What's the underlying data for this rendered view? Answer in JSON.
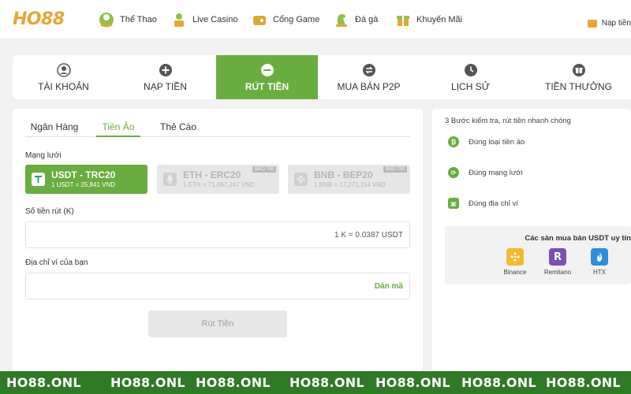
{
  "brand": {
    "logo_left": "HO",
    "logo_right": "88"
  },
  "nav": {
    "items": [
      {
        "label": "Thể Thao",
        "icon": "soccer-ball-icon"
      },
      {
        "label": "Live Casino",
        "icon": "dealer-icon"
      },
      {
        "label": "Cổng Game",
        "icon": "game-icon"
      },
      {
        "label": "Đá gà",
        "icon": "rooster-icon"
      },
      {
        "label": "Khuyến Mãi",
        "icon": "gift-icon"
      }
    ],
    "deposit_link": "Nạp tiền"
  },
  "tabs": [
    {
      "label": "TÀI KHOẢN",
      "icon": "user-icon",
      "active": false
    },
    {
      "label": "NẠP TIỀN",
      "icon": "plus-circle-icon",
      "active": false
    },
    {
      "label": "RÚT TIỀN",
      "icon": "minus-circle-icon",
      "active": true
    },
    {
      "label": "MUA BÁN P2P",
      "icon": "exchange-icon",
      "active": false
    },
    {
      "label": "LỊCH SỬ",
      "icon": "clock-icon",
      "active": false
    },
    {
      "label": "TIỀN THƯỞNG",
      "icon": "gift-icon",
      "active": false
    }
  ],
  "withdraw": {
    "subtabs": [
      "Ngân Hàng",
      "Tiền Ảo",
      "Thẻ Cào"
    ],
    "active_subtab": "Tiền Ảo",
    "network_label": "Mạng lưới",
    "networks": [
      {
        "name": "USDT - TRC20",
        "rate": "1 USDT = 25,841 VND",
        "active": true,
        "badge": ""
      },
      {
        "name": "ETH - ERC20",
        "rate": "1 ETH = 71,067,247 VND",
        "active": false,
        "badge": "BẢO TRÌ"
      },
      {
        "name": "BNB - BEP20",
        "rate": "1 BNB = 17,271,114 VND",
        "active": false,
        "badge": "BẢO TRÌ"
      }
    ],
    "amount_label": "Số tiền rút (K)",
    "amount_value": "",
    "amount_hint": "1 K = 0.0387 USDT",
    "address_label": "Địa chỉ ví của bạn",
    "address_value": "",
    "paste_label": "Dán mã",
    "submit_label": "Rút Tiền"
  },
  "guide": {
    "title": "3 Bước kiểm tra, rút tiền nhanh chóng",
    "steps": [
      "Đúng loại tiền ảo",
      "Đúng mạng lưới",
      "Đúng địa chỉ ví"
    ],
    "exchanges_title": "Các sàn mua bán USDT uy tín",
    "exchanges": [
      {
        "name": "Binance",
        "color": "#f3ba2f"
      },
      {
        "name": "Remitano",
        "color": "#7b4fb3"
      },
      {
        "name": "HTX",
        "color": "#2e8ede"
      }
    ]
  },
  "watermark": "HO88.ONL",
  "colors": {
    "accent": "#6aad3f",
    "brand": "#e8a533",
    "strip": "#2f7a25"
  }
}
